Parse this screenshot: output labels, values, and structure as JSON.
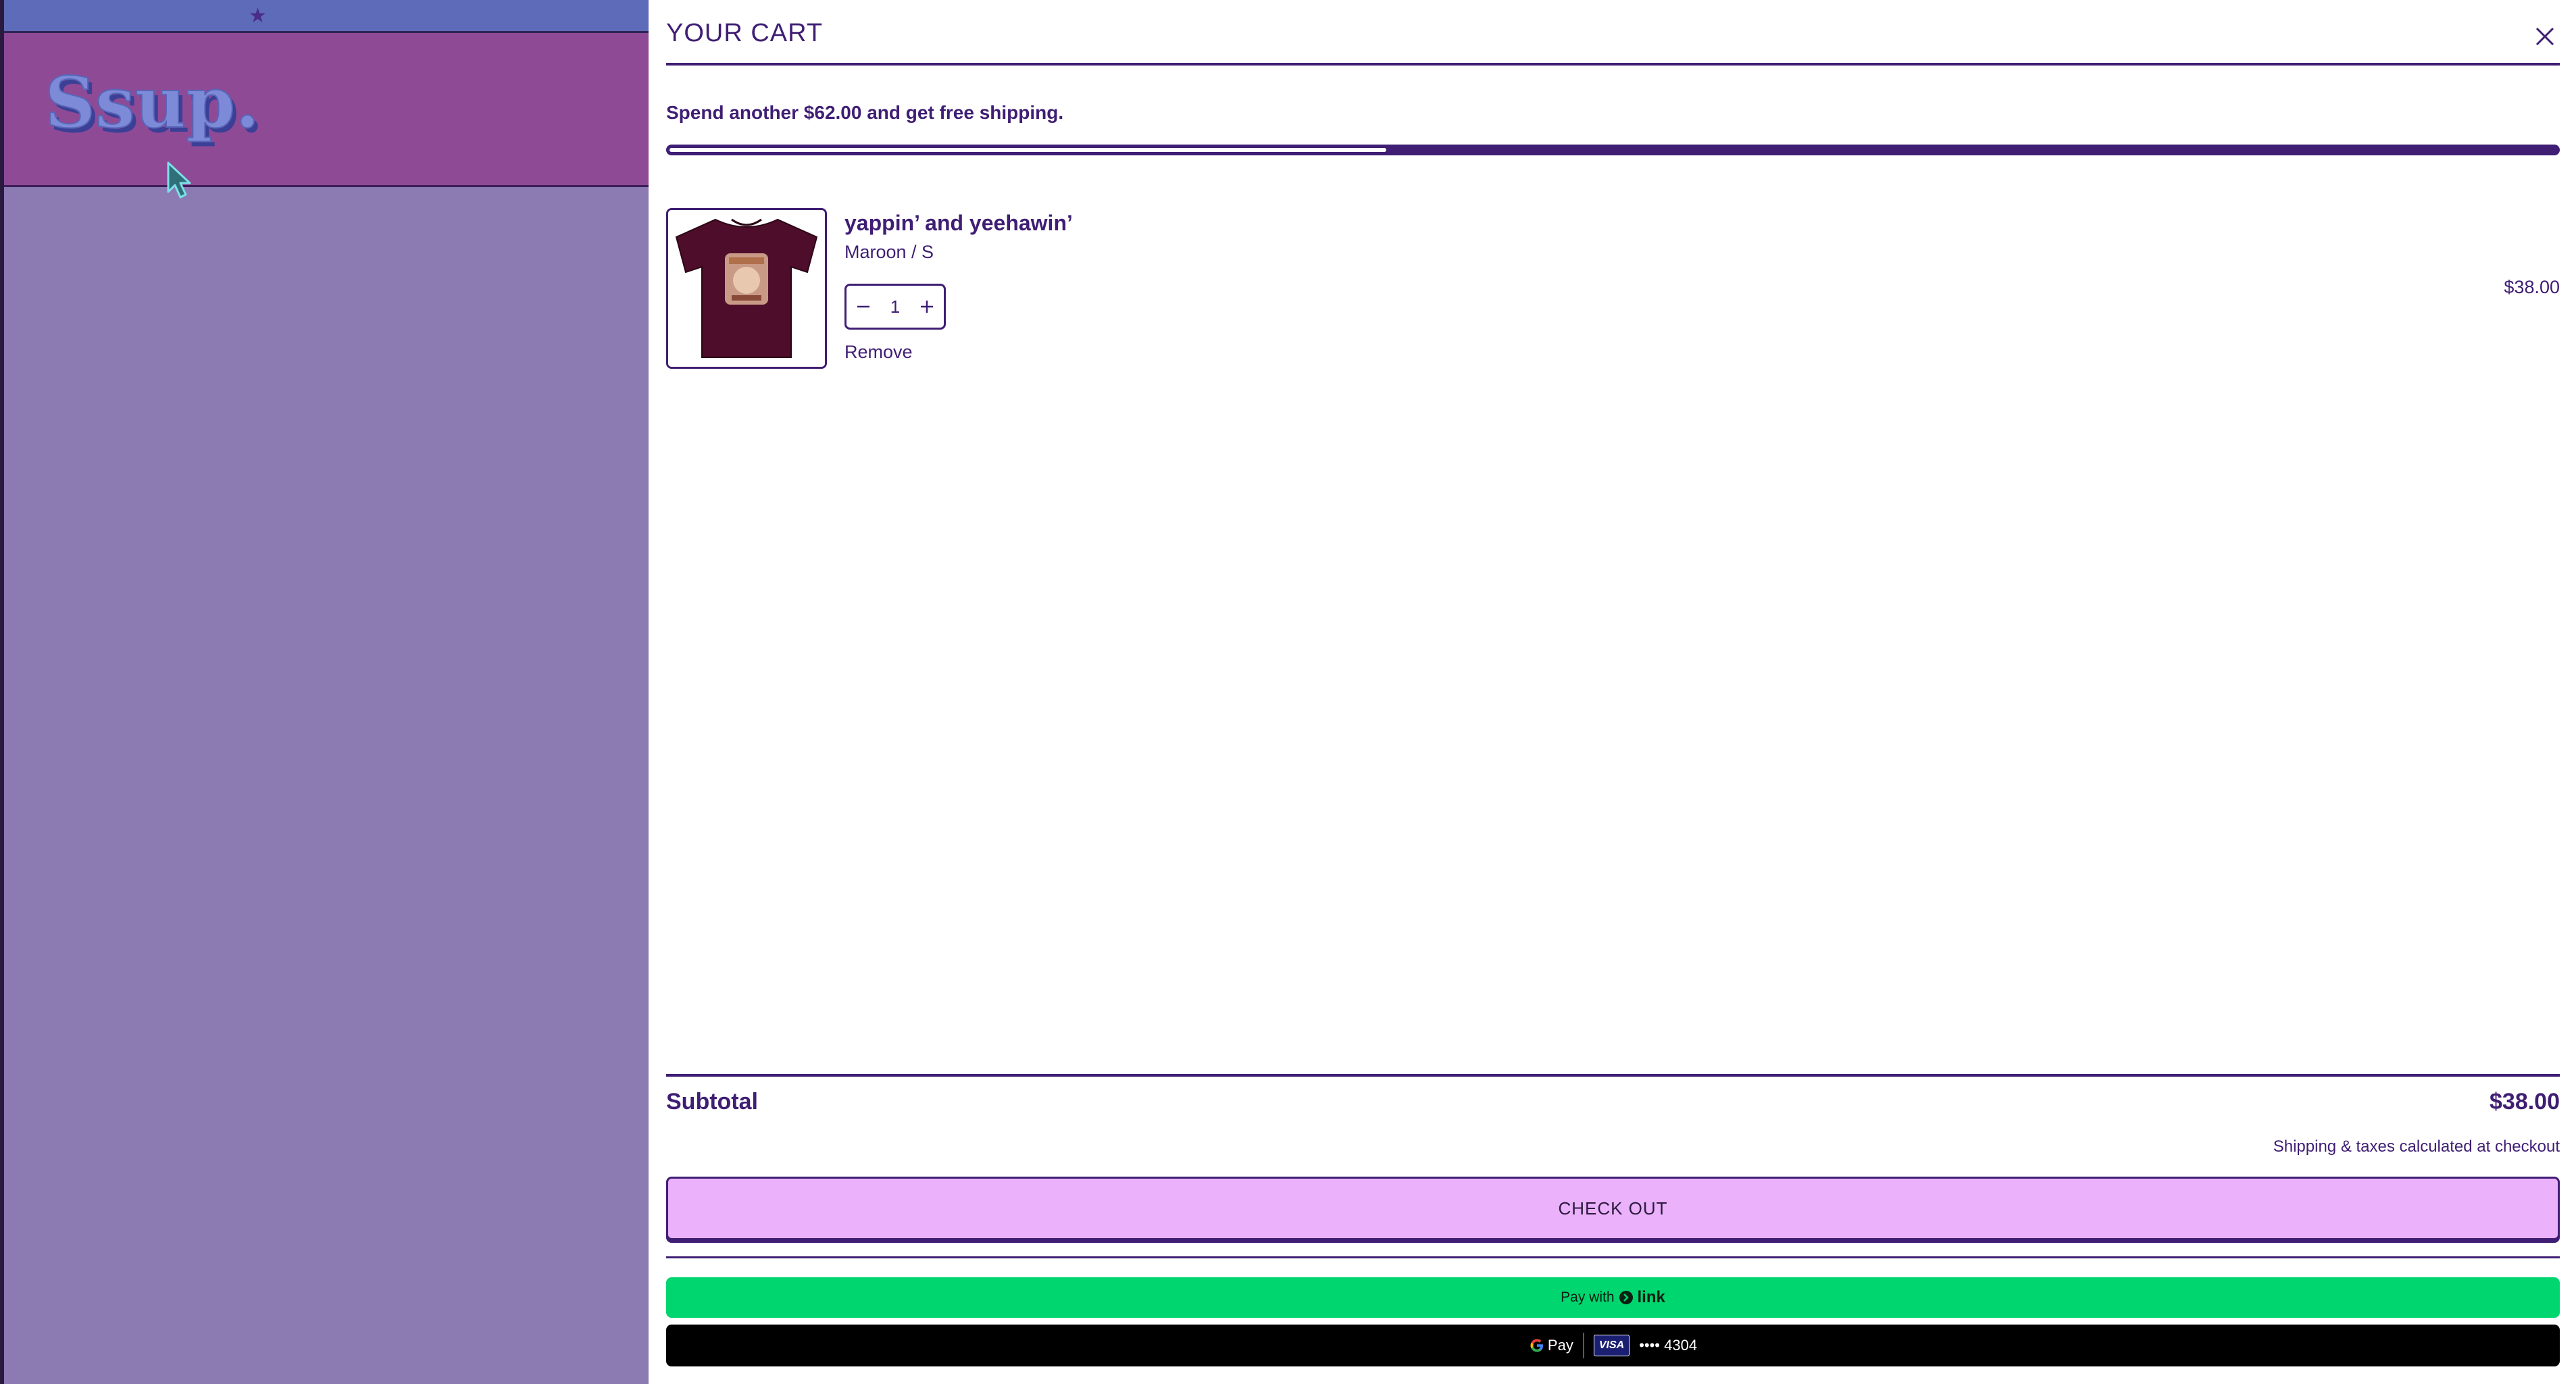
{
  "store": {
    "logo_text": "Ssup.",
    "announcement_icon": "star-icon"
  },
  "cart": {
    "title": "YOUR CART",
    "close_icon": "close-icon",
    "shipping_message": "Spend another $62.00 and get free shipping.",
    "shipping_progress": 0.38,
    "items": [
      {
        "name": "yappin’ and yeehawin’",
        "variant": "Maroon / S",
        "quantity": "1",
        "remove_label": "Remove",
        "price": "$38.00",
        "image": "maroon-tshirt"
      }
    ],
    "subtotal_label": "Subtotal",
    "subtotal_value": "$38.00",
    "tax_note": "Shipping & taxes calculated at checkout",
    "checkout_label": "CHECK OUT",
    "link_pay": {
      "prefix": "Pay with",
      "brand": "link"
    },
    "gpay": {
      "brand": "Pay",
      "card_brand": "VISA",
      "card_masked": "•••• 4304"
    }
  },
  "colors": {
    "accent": "#3f1e74",
    "checkout_bg": "#ebb1fb",
    "link_green": "#00d66f",
    "header_purple": "#8f4a96",
    "page_bg": "#8c7ab3"
  }
}
